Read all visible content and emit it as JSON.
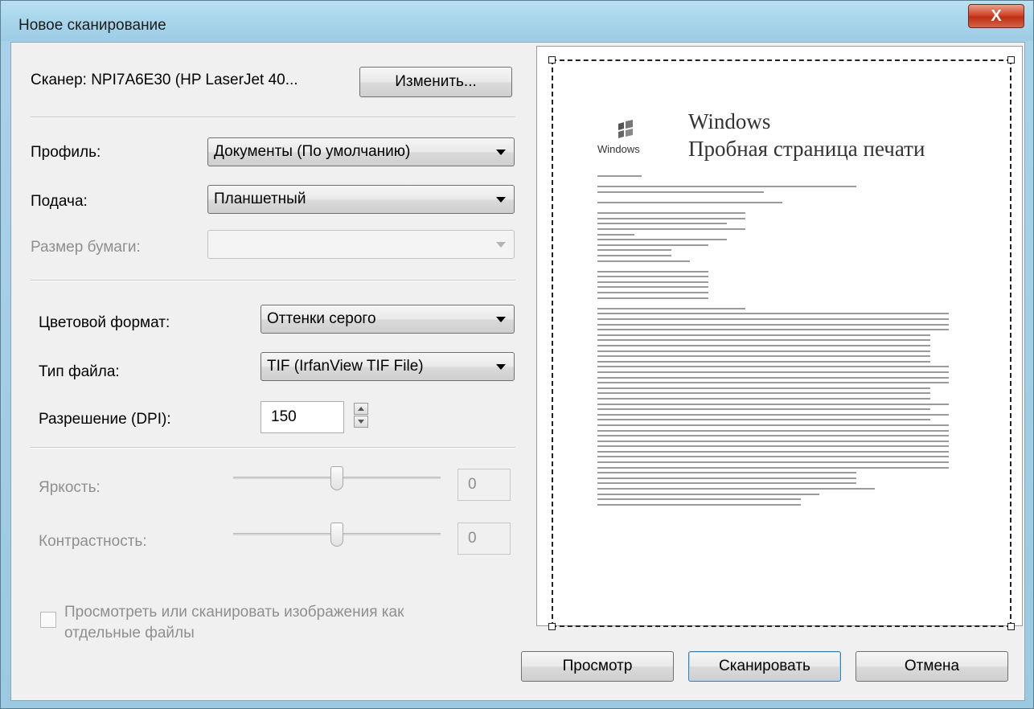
{
  "window": {
    "title": "Новое сканирование",
    "close_glyph": "X"
  },
  "scanner": {
    "label": "Сканер: NPI7A6E30 (HP LaserJet 40...",
    "change_button": "Изменить..."
  },
  "profile": {
    "label": "Профиль:",
    "value": "Документы (По умолчанию)"
  },
  "source": {
    "label": "Подача:",
    "value": "Планшетный"
  },
  "paper_size": {
    "label": "Размер бумаги:",
    "value": ""
  },
  "color_format": {
    "label": "Цветовой формат:",
    "value": "Оттенки серого"
  },
  "file_type": {
    "label": "Тип файла:",
    "value": "TIF (IrfanView TIF File)"
  },
  "resolution": {
    "label": "Разрешение (DPI):",
    "value": "150"
  },
  "brightness": {
    "label": "Яркость:",
    "value": "0",
    "level": 0.5
  },
  "contrast": {
    "label": "Контрастность:",
    "value": "0",
    "level": 0.5
  },
  "separate_files": {
    "label_line1": "Просмотреть или сканировать изображения как",
    "label_line2": "отдельные файлы",
    "checked": false
  },
  "preview_doc": {
    "logo_text": "Windows",
    "title": "Windows",
    "subtitle": "Пробная страница печати"
  },
  "buttons": {
    "preview": "Просмотр",
    "scan": "Сканировать",
    "cancel": "Отмена"
  },
  "colors": {
    "title_bar": "#a5d3ea",
    "close_button": "#c9422a",
    "dialog_bg": "#f0f0f0"
  }
}
